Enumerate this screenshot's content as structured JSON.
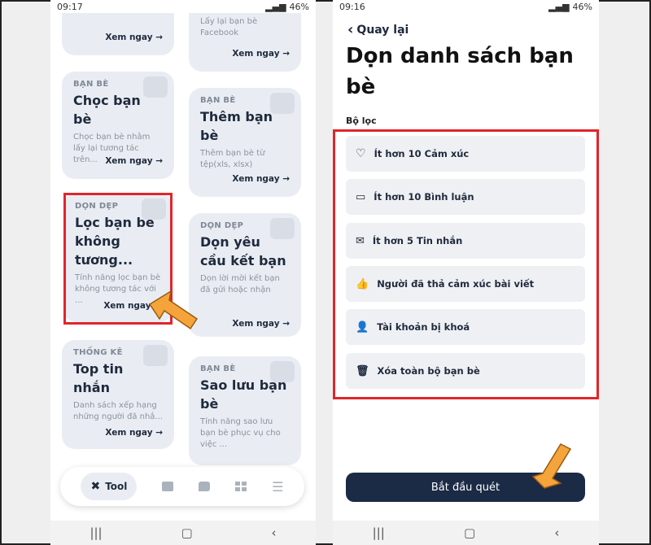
{
  "left": {
    "status": {
      "time": "09:17",
      "battery": "46%"
    },
    "cards": [
      {
        "category": "",
        "title": "",
        "desc": "",
        "link": "Xem ngay →"
      },
      {
        "category": "",
        "title": "",
        "desc": "Lấy lại bạn bè Facebook",
        "link": "Xem ngay →"
      },
      {
        "category": "BẠN BÈ",
        "title": "Chọc bạn bè",
        "desc": "Chọc bạn bè nhằm lấy lại tương tác trên...",
        "link": "Xem ngay →"
      },
      {
        "category": "BẠN BÈ",
        "title": "Thêm bạn bè",
        "desc": "Thêm bạn bè từ tệp(xls, xlsx)",
        "link": "Xem ngay →"
      },
      {
        "category": "DỌN DẸP",
        "title": "Lọc bạn bè không tương...",
        "desc": "Tính năng lọc bạn bè không tương tác với ...",
        "link": "Xem ngay →"
      },
      {
        "category": "DỌN DẸP",
        "title": "Dọn yêu cầu kết bạn",
        "desc": "Dọn lời mời kết bạn đã gửi hoặc nhận",
        "link": "Xem ngay →"
      },
      {
        "category": "THỐNG KÊ",
        "title": "Top tin nhắn",
        "desc": "Danh sách xếp hạng những người đã nhắ...",
        "link": "Xem ngay →"
      },
      {
        "category": "BẠN BÈ",
        "title": "Sao lưu bạn bè",
        "desc": "Tính năng sao lưu bạn bè phục vụ cho việc ...",
        "link": ""
      }
    ],
    "tabbar": {
      "tool_label": "Tool"
    }
  },
  "right": {
    "status": {
      "time": "09:16",
      "battery": "46%"
    },
    "back_label": "Quay lại",
    "title": "Dọn danh sách bạn bè",
    "filter_label": "Bộ lọc",
    "filters": [
      {
        "icon": "heart-icon",
        "label": "Ít hơn 10 Cảm xúc"
      },
      {
        "icon": "comment-icon",
        "label": "Ít hơn 10 Bình luận"
      },
      {
        "icon": "mail-icon",
        "label": "Ít hơn 5 Tin nhắn"
      },
      {
        "icon": "thumbs-up-icon",
        "label": "Người đã thả cảm xúc bài viết"
      },
      {
        "icon": "locked-user-icon",
        "label": "Tài khoản bị khoá"
      },
      {
        "icon": "trash-icon",
        "label": "Xóa toàn bộ bạn bè"
      }
    ],
    "scan_button": "Bắt đầu quét"
  },
  "colors": {
    "highlight": "#e0252c",
    "arrow": "#f5a43c",
    "primary": "#1b2a45",
    "card": "#e9edf3"
  }
}
